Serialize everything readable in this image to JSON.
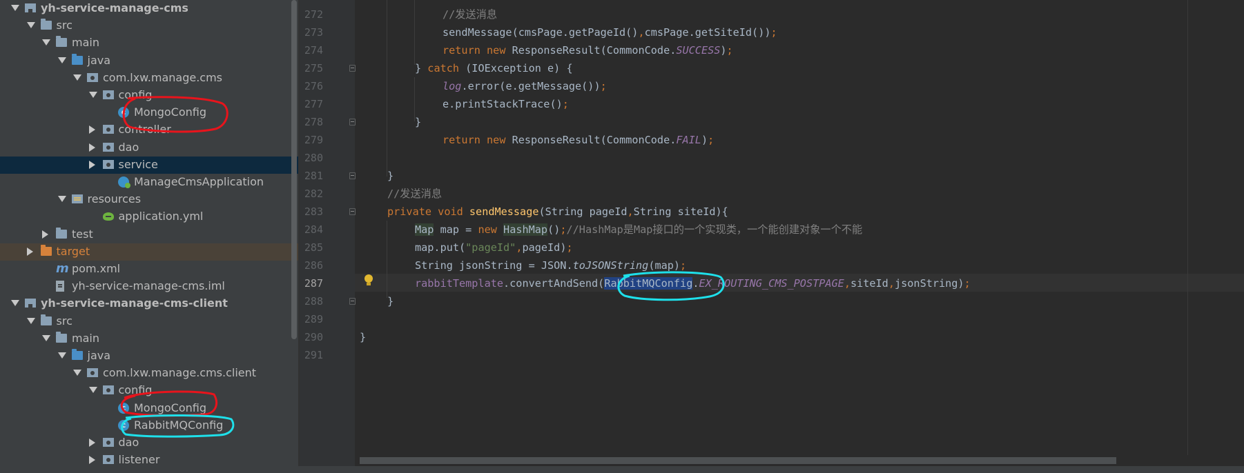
{
  "project_tree": {
    "items": [
      {
        "label": "yh-service-manage-cms",
        "depth": 0,
        "arrow": "down",
        "icon": "module-folder-icon",
        "bold": true
      },
      {
        "label": "src",
        "depth": 1,
        "arrow": "down",
        "icon": "folder-icon"
      },
      {
        "label": "main",
        "depth": 2,
        "arrow": "down",
        "icon": "folder-icon"
      },
      {
        "label": "java",
        "depth": 3,
        "arrow": "down",
        "icon": "source-folder-icon"
      },
      {
        "label": "com.lxw.manage.cms",
        "depth": 4,
        "arrow": "down",
        "icon": "package-icon"
      },
      {
        "label": "config",
        "depth": 5,
        "arrow": "down",
        "icon": "package-icon"
      },
      {
        "label": "MongoConfig",
        "depth": 6,
        "arrow": "none",
        "icon": "java-class-icon"
      },
      {
        "label": "controller",
        "depth": 5,
        "arrow": "right",
        "icon": "package-icon"
      },
      {
        "label": "dao",
        "depth": 5,
        "arrow": "right",
        "icon": "package-icon"
      },
      {
        "label": "service",
        "depth": 5,
        "arrow": "right",
        "icon": "package-icon",
        "selected": true
      },
      {
        "label": "ManageCmsApplication",
        "depth": 6,
        "arrow": "none",
        "icon": "spring-boot-class-icon"
      },
      {
        "label": "resources",
        "depth": 3,
        "arrow": "down",
        "icon": "resources-folder-icon"
      },
      {
        "label": "application.yml",
        "depth": 5,
        "arrow": "none",
        "icon": "yml-file-icon"
      },
      {
        "label": "test",
        "depth": 2,
        "arrow": "right",
        "icon": "folder-icon"
      },
      {
        "label": "target",
        "depth": 1,
        "arrow": "right",
        "icon": "excluded-folder-icon",
        "excluded": true
      },
      {
        "label": "pom.xml",
        "depth": 2,
        "arrow": "none",
        "icon": "maven-icon"
      },
      {
        "label": "yh-service-manage-cms.iml",
        "depth": 2,
        "arrow": "none",
        "icon": "iml-file-icon"
      },
      {
        "label": "yh-service-manage-cms-client",
        "depth": 0,
        "arrow": "down",
        "icon": "module-folder-icon",
        "bold": true
      },
      {
        "label": "src",
        "depth": 1,
        "arrow": "down",
        "icon": "folder-icon"
      },
      {
        "label": "main",
        "depth": 2,
        "arrow": "down",
        "icon": "folder-icon"
      },
      {
        "label": "java",
        "depth": 3,
        "arrow": "down",
        "icon": "source-folder-icon"
      },
      {
        "label": "com.lxw.manage.cms.client",
        "depth": 4,
        "arrow": "down",
        "icon": "package-icon"
      },
      {
        "label": "config",
        "depth": 5,
        "arrow": "down",
        "icon": "package-icon"
      },
      {
        "label": "MongoConfig",
        "depth": 6,
        "arrow": "none",
        "icon": "java-class-icon"
      },
      {
        "label": "RabbitMQConfig",
        "depth": 6,
        "arrow": "none",
        "icon": "java-class-icon"
      },
      {
        "label": "dao",
        "depth": 5,
        "arrow": "right",
        "icon": "package-icon"
      },
      {
        "label": "listener",
        "depth": 5,
        "arrow": "right",
        "icon": "package-icon"
      }
    ]
  },
  "editor": {
    "line_numbers": [
      "272",
      "273",
      "274",
      "275",
      "276",
      "277",
      "278",
      "279",
      "280",
      "281",
      "282",
      "283",
      "284",
      "285",
      "286",
      "287",
      "288",
      "289",
      "290",
      "291"
    ],
    "current_line": "287",
    "lines": {
      "l272": {
        "comment": "//发送消息"
      },
      "l273": {
        "a": "sendMessage(cmsPage.getPageId()",
        "b": ",",
        "c": "cmsPage.getSiteId())",
        "d": ";"
      },
      "l274": {
        "kw1": "return",
        "kw2": "new",
        "a": "ResponseResult(CommonCode.",
        "const": "SUCCESS",
        "b": ")",
        "c": ";"
      },
      "l275": {
        "a": "} ",
        "kw": "catch",
        "b": " (IOException e) {"
      },
      "l276": {
        "fld": "log",
        "a": ".error(e.getMessage())",
        "b": ";"
      },
      "l277": {
        "a": "e.printStackTrace()",
        "b": ";"
      },
      "l278": {
        "a": "}"
      },
      "l279": {
        "kw1": "return",
        "kw2": "new",
        "a": "ResponseResult(CommonCode.",
        "const": "FAIL",
        "b": ")",
        "c": ";"
      },
      "l281": {
        "a": "}"
      },
      "l282": {
        "comment": "//发送消息"
      },
      "l283": {
        "kw1": "private",
        "kw2": "void",
        "fn": "sendMessage",
        "a": "(String pageId",
        "b": ",",
        "c": "String siteId){"
      },
      "l284": {
        "type1": "Map",
        "a": " map = ",
        "kw": "new",
        "type2": "HashMap",
        "b": "()",
        "c": ";",
        "comment": "//HashMap是Map接口的一个实现类，一个能创建对象一个不能"
      },
      "l285": {
        "a": "map.put(",
        "str": "\"pageId\"",
        "b": ",",
        "c": "pageId)",
        "d": ";"
      },
      "l286": {
        "a": "String jsonString = JSON.",
        "it": "toJSONString",
        "b": "(map)",
        "c": ";"
      },
      "l287": {
        "fld": "rabbitTemplate",
        "a": ".convertAndSend(",
        "sel": "RabbitMQConfig",
        "b": ".",
        "const": "EX_ROUTING_CMS_POSTPAGE",
        "c": ",",
        "d": "siteId",
        "e": ",",
        "f": "jsonString)",
        "g": ";"
      },
      "l288": {
        "a": "}"
      },
      "l290": {
        "a": "}"
      }
    }
  },
  "annotations": {
    "red_color": "#e8141c",
    "cyan_color": "#1ee0ea"
  },
  "colors": {
    "tree_bg": "#3c3f41",
    "editor_bg": "#2b2b2b",
    "gutter_bg": "#313335",
    "keyword": "#cc7832",
    "comment": "#808080",
    "string": "#6a8759",
    "constant": "#9876aa",
    "function": "#ffc66d",
    "default_text": "#a9b7c6"
  }
}
